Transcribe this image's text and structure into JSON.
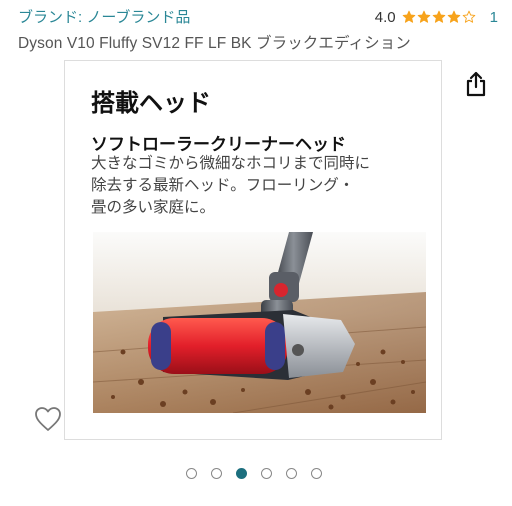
{
  "header": {
    "brand_link": "ブランド: ノーブランド品",
    "rating_value": "4.0",
    "rating_stars": 4,
    "review_count": "1",
    "product_title": "Dyson V10 Fluffy SV12 FF LF BK ブラックエディション"
  },
  "image_card": {
    "heading": "搭載ヘッド",
    "subheading": "ソフトローラークリーナーヘッド",
    "description_lines": [
      "大きなゴミから微細なホコリまで同時に",
      "除去する最新ヘッド。フローリング・",
      "畳の多い家庭に。"
    ]
  },
  "carousel": {
    "total": 6,
    "active_index": 2
  },
  "colors": {
    "link": "#2a8796",
    "star": "#f7a31c",
    "active_dot": "#1c6f7e"
  },
  "icons": {
    "share": "share-icon",
    "wishlist": "heart-icon",
    "star": "star-icon"
  }
}
